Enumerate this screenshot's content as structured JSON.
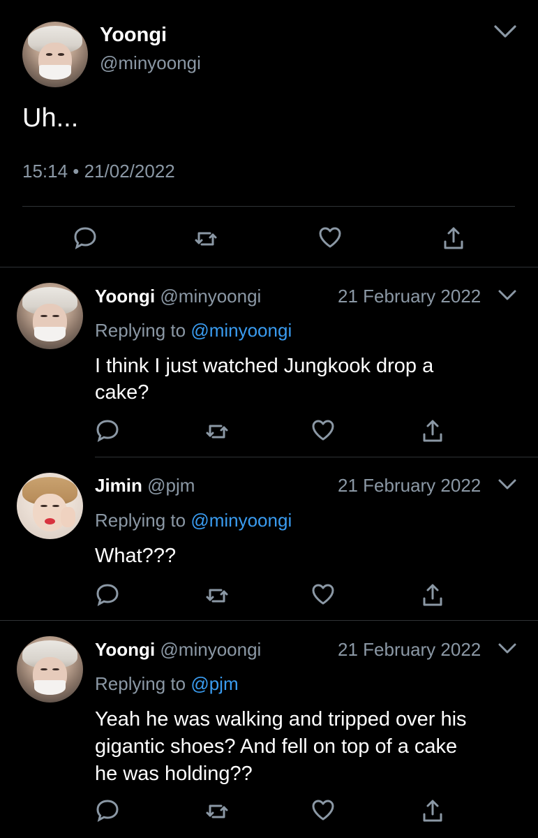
{
  "main_tweet": {
    "name": "Yoongi",
    "handle": "@minyoongi",
    "text": "Uh...",
    "timestamp": "15:14 • 21/02/2022"
  },
  "replies": [
    {
      "name": "Yoongi",
      "handle": "@minyoongi",
      "date": "21 February 2022",
      "replying_prefix": "Replying to ",
      "replying_to": "@minyoongi",
      "text_lines": [
        "I think I just watched Jungkook drop a",
        "cake?"
      ]
    },
    {
      "name": "Jimin",
      "handle": "@pjm",
      "date": "21 February 2022",
      "replying_prefix": "Replying to ",
      "replying_to": "@minyoongi",
      "text_lines": [
        "What???"
      ]
    },
    {
      "name": "Yoongi",
      "handle": "@minyoongi",
      "date": "21 February 2022",
      "replying_prefix": "Replying to ",
      "replying_to": "@pjm",
      "text_lines": [
        "Yeah he was walking and tripped over his",
        "gigantic shoes? And fell on top of a cake",
        "he was holding??"
      ]
    }
  ],
  "icons": {
    "reply": "reply-icon",
    "retweet": "retweet-icon",
    "like": "heart-icon",
    "share": "share-icon",
    "more": "chevron-down-icon"
  },
  "colors": {
    "background": "#000000",
    "text": "#ffffff",
    "muted": "#8b98a5",
    "link": "#3a9cf0",
    "divider": "#2f3336"
  }
}
